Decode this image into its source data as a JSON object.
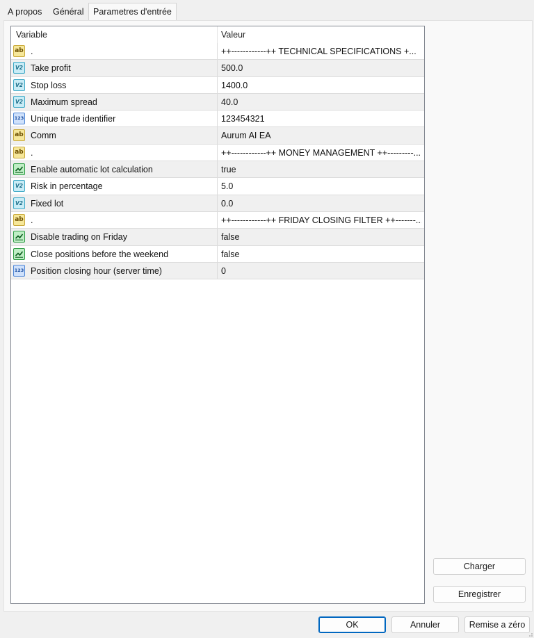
{
  "tabs": [
    {
      "label": "A propos"
    },
    {
      "label": "Général"
    },
    {
      "label": "Parametres d'entrée"
    }
  ],
  "table": {
    "columns": {
      "variable": "Variable",
      "value": "Valeur"
    },
    "rows": [
      {
        "icon": "ab-string-icon",
        "type": "ab",
        "name": ".",
        "value": "++------------++  TECHNICAL SPECIFICATIONS  +..."
      },
      {
        "icon": "double-value-icon",
        "type": "v2",
        "name": "Take profit",
        "value": "500.0"
      },
      {
        "icon": "double-value-icon",
        "type": "v2",
        "name": "Stop loss",
        "value": "1400.0"
      },
      {
        "icon": "double-value-icon",
        "type": "v2",
        "name": "Maximum spread",
        "value": "40.0"
      },
      {
        "icon": "integer-value-icon",
        "type": "n123",
        "name": "Unique trade identifier",
        "value": "123454321"
      },
      {
        "icon": "ab-string-icon",
        "type": "ab",
        "name": "Comm",
        "value": "Aurum AI EA"
      },
      {
        "icon": "ab-string-icon",
        "type": "ab",
        "name": ".",
        "value": "++------------++  MONEY MANAGEMENT  ++---------..."
      },
      {
        "icon": "boolean-value-icon",
        "type": "bool",
        "name": "Enable automatic lot calculation",
        "value": "true"
      },
      {
        "icon": "double-value-icon",
        "type": "v2",
        "name": "Risk in percentage",
        "value": "5.0"
      },
      {
        "icon": "double-value-icon",
        "type": "v2",
        "name": "Fixed lot",
        "value": "0.0"
      },
      {
        "icon": "ab-string-icon",
        "type": "ab",
        "name": ".",
        "value": "++------------++  FRIDAY CLOSING FILTER  ++-------..."
      },
      {
        "icon": "boolean-value-icon",
        "type": "bool",
        "name": "Disable trading on Friday",
        "value": "false"
      },
      {
        "icon": "boolean-value-icon",
        "type": "bool",
        "name": "Close positions before the weekend",
        "value": "false"
      },
      {
        "icon": "integer-value-icon",
        "type": "n123",
        "name": "Position closing hour (server time)",
        "value": "0"
      }
    ]
  },
  "icons": {
    "ab": "ab",
    "v2": "V2",
    "n123": "123"
  },
  "side_buttons": {
    "load": "Charger",
    "save": "Enregistrer"
  },
  "footer_buttons": {
    "ok": "OK",
    "cancel": "Annuler",
    "reset": "Remise a zéro"
  },
  "colors": {
    "accent": "#0067c0"
  }
}
